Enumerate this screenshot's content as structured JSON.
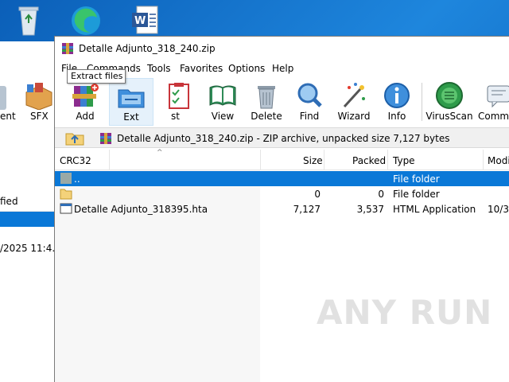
{
  "window": {
    "title": "Detalle Adjunto_318_240.zip"
  },
  "menu": [
    "File",
    "Commands",
    "Tools",
    "Favorites",
    "Options",
    "Help"
  ],
  "toolbar": {
    "buttons": [
      {
        "label": "Add"
      },
      {
        "label": "Ext"
      },
      {
        "label": "st"
      },
      {
        "label": "View"
      },
      {
        "label": "Delete"
      },
      {
        "label": "Find"
      },
      {
        "label": "Wizard"
      },
      {
        "label": "Info"
      },
      {
        "label": "VirusScan"
      },
      {
        "label": "Comm"
      }
    ],
    "tooltip": "Extract files"
  },
  "pathbar": {
    "text": "Detalle Adjunto_318_240.zip - ZIP archive, unpacked size 7,127 bytes"
  },
  "list": {
    "columns": [
      "CRC32",
      "Size",
      "Packed",
      "Type",
      "Modi"
    ],
    "rows": [
      {
        "name": "..",
        "size": "",
        "packed": "",
        "type": "File folder",
        "modified": "",
        "selected": true
      },
      {
        "name": "",
        "size": "0",
        "packed": "0",
        "type": "File folder",
        "modified": "",
        "selected": false
      },
      {
        "name": "Detalle Adjunto_318395.hta",
        "size": "7,127",
        "packed": "3,537",
        "type": "HTML Application",
        "modified": "10/3/",
        "selected": false
      }
    ]
  },
  "back_window": {
    "toolbar_labels": [
      "ent",
      "SFX"
    ],
    "column_header": "fied",
    "row_date": "/2025 11:4..."
  },
  "watermark": "ANY RUN"
}
